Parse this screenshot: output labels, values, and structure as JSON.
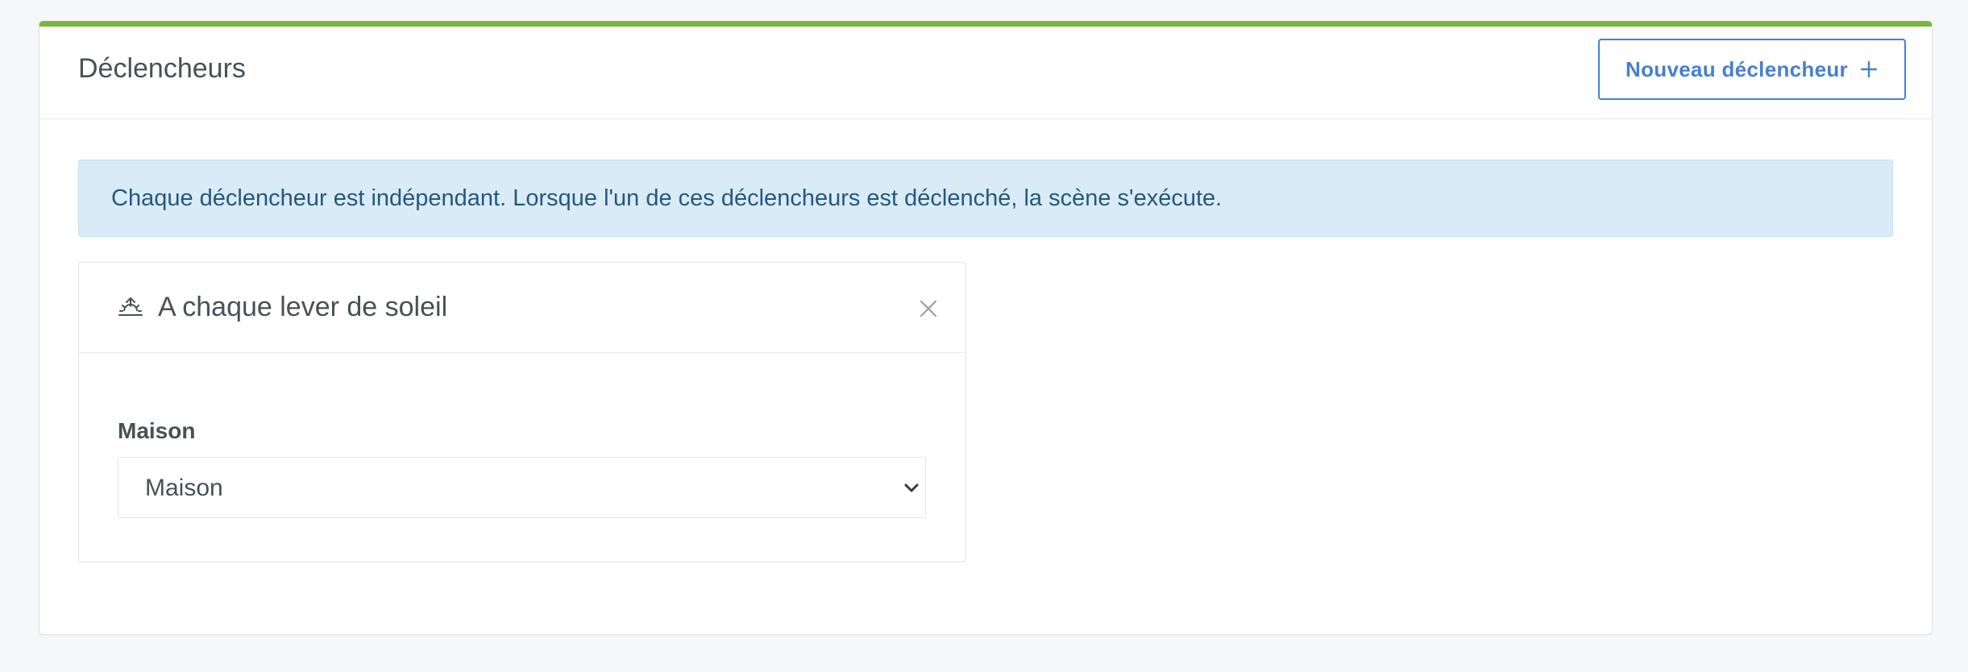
{
  "header": {
    "title": "Déclencheurs",
    "new_trigger_label": "Nouveau déclencheur"
  },
  "alert": {
    "text": "Chaque déclencheur est indépendant. Lorsque l'un de ces déclencheurs est déclenché, la scène s'exécute."
  },
  "trigger": {
    "title": "A chaque lever de soleil",
    "icon": "sunrise-icon",
    "house_label": "Maison",
    "house_selected": "Maison"
  },
  "colors": {
    "accent": "#7bb73b",
    "primary": "#467fcf",
    "alert_bg": "#daebf8",
    "alert_text": "#24587e"
  }
}
